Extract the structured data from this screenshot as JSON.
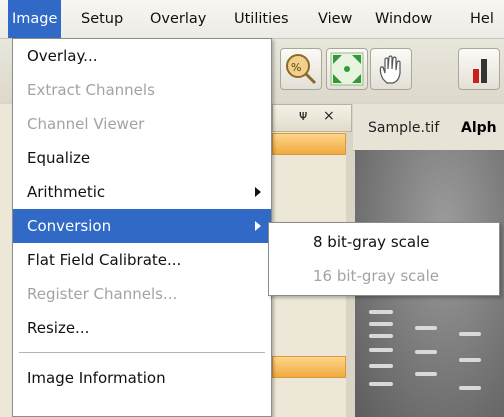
{
  "menubar": {
    "items": [
      "Image",
      "Setup",
      "Overlay",
      "Utilities",
      "View",
      "Window",
      "Hel"
    ]
  },
  "image_menu": {
    "items": [
      {
        "label": "Overlay...",
        "enabled": true
      },
      {
        "label": "Extract Channels",
        "enabled": false
      },
      {
        "label": "Channel Viewer",
        "enabled": false
      },
      {
        "label": "Equalize",
        "enabled": true
      },
      {
        "label": "Arithmetic",
        "enabled": true,
        "submenu": true
      },
      {
        "label": "Conversion",
        "enabled": true,
        "submenu": true,
        "highlighted": true
      },
      {
        "label": "Flat Field Calibrate...",
        "enabled": true
      },
      {
        "label": "Register Channels...",
        "enabled": false
      },
      {
        "label": "Resize...",
        "enabled": true
      },
      {
        "label": "Image Information",
        "enabled": true
      }
    ]
  },
  "conversion_submenu": {
    "items": [
      {
        "label": "8 bit-gray scale",
        "enabled": true
      },
      {
        "label": "16 bit-gray scale",
        "enabled": false
      }
    ]
  },
  "panel": {
    "pin_glyph": "14",
    "close_glyph": "×"
  },
  "document_tabs": [
    "Sample.tif",
    "Alph"
  ],
  "colors": {
    "highlight": "#3169c6",
    "disabled_text": "#a3a3a3",
    "accent_orange": "#f2aa3f"
  }
}
